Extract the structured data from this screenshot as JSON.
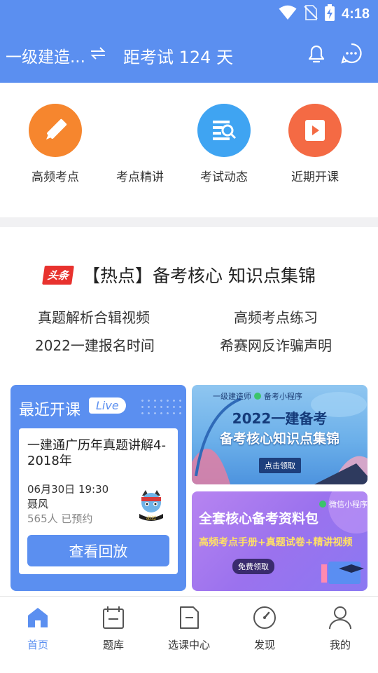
{
  "status_bar": {
    "time": "4:18"
  },
  "header": {
    "exam_name": "一级建造...",
    "countdown": "距考试 124 天"
  },
  "quick_entries": [
    {
      "label": "高频考点",
      "icon": "pencil-icon",
      "color": "#f6862e"
    },
    {
      "label": "考点精讲",
      "icon": "",
      "color": ""
    },
    {
      "label": "考试动态",
      "icon": "news-search-icon",
      "color": "#3fa4f2"
    },
    {
      "label": "近期开课",
      "icon": "video-play-icon",
      "color": "#f46a44"
    }
  ],
  "hot_news": {
    "tag": "头条",
    "headline": "【热点】备考核心 知识点集锦",
    "links": [
      "真题解析合辑视频",
      "高频考点练习",
      "2022一建报名时间",
      "希赛网反诈骗声明"
    ]
  },
  "recent_courses": {
    "title": "最近开课",
    "live_badge": "Live",
    "course_title": "一建通广历年真题讲解4-2018年",
    "date": "06月30日 19:30",
    "teacher": "聂风",
    "reserved": "565人 已预约",
    "avatar_text": "必过",
    "replay_button": "查看回放"
  },
  "banner1": {
    "top_label": "一级建造师",
    "mini_program": "备考小程序",
    "line1": "2022一建备考",
    "line2": "备考核心知识点集锦",
    "button": "点击领取"
  },
  "banner2": {
    "mini_program": "微信小程序",
    "title": "全套核心备考资料包",
    "subtitle": "高频考点手册+真题试卷+精讲视频",
    "button": "免费领取"
  },
  "tabs": [
    {
      "label": "首页",
      "icon": "home-icon",
      "active": true
    },
    {
      "label": "题库",
      "icon": "calendar-icon",
      "active": false
    },
    {
      "label": "选课中心",
      "icon": "document-icon",
      "active": false
    },
    {
      "label": "发现",
      "icon": "compass-icon",
      "active": false
    },
    {
      "label": "我的",
      "icon": "user-icon",
      "active": false
    }
  ],
  "colors": {
    "brand_blue": "#5b8ff0",
    "accent_red": "#e8322e"
  }
}
